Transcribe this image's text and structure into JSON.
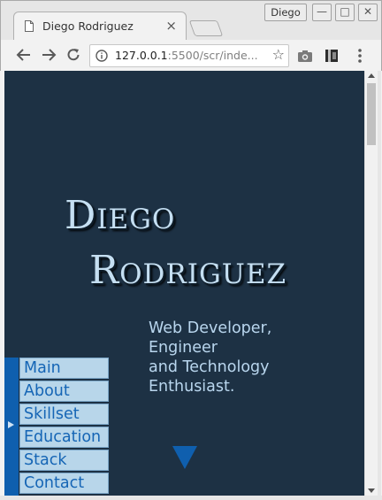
{
  "browser": {
    "tab_title": "Diego Rodriguez",
    "tab_close": "×",
    "profile_name": "Diego",
    "url_host": "127.0.0.1",
    "url_rest": ":5500/scr/inde...",
    "icons": {
      "favicon": "page-icon",
      "back": "arrow-left-icon",
      "forward": "arrow-right-icon",
      "reload": "reload-icon",
      "info": "info-icon",
      "star": "star-icon",
      "camera": "camera-icon",
      "extension": "extension-icon",
      "menu": "kebab-menu-icon"
    },
    "window_buttons": {
      "minimize": "—",
      "maximize": "□",
      "close": "✕"
    }
  },
  "page": {
    "name_first": "Diego",
    "name_last": "Rodriguez",
    "tagline": [
      "Web Developer,",
      "Engineer",
      "and Technology",
      "Enthusiast."
    ],
    "nav_items": [
      "Main",
      "About",
      "Skillset",
      "Education",
      "Stack",
      "Contact"
    ],
    "colors": {
      "background": "#1d3144",
      "accent": "#0f5fae",
      "name_text": "#c5dff2",
      "nav_item_bg": "#b8d6ea",
      "nav_item_text": "#1565b5"
    }
  }
}
